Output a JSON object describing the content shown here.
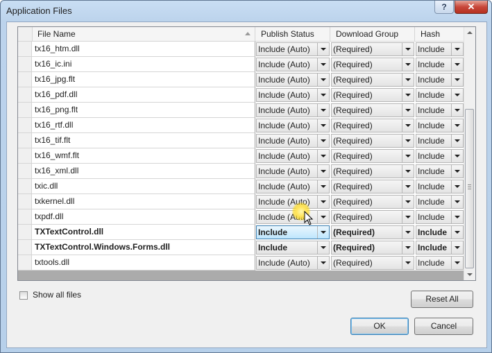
{
  "window": {
    "title": "Application Files",
    "help_label": "?",
    "close_label": "✕"
  },
  "grid": {
    "columns": {
      "name": "File Name",
      "status": "Publish Status",
      "group": "Download Group",
      "hash": "Hash"
    },
    "rows": [
      {
        "name": "tx16_htm.dll",
        "status": "Include (Auto)",
        "group": "(Required)",
        "hash": "Include"
      },
      {
        "name": "tx16_ic.ini",
        "status": "Include (Auto)",
        "group": "(Required)",
        "hash": "Include"
      },
      {
        "name": "tx16_jpg.flt",
        "status": "Include (Auto)",
        "group": "(Required)",
        "hash": "Include"
      },
      {
        "name": "tx16_pdf.dll",
        "status": "Include (Auto)",
        "group": "(Required)",
        "hash": "Include"
      },
      {
        "name": "tx16_png.flt",
        "status": "Include (Auto)",
        "group": "(Required)",
        "hash": "Include"
      },
      {
        "name": "tx16_rtf.dll",
        "status": "Include (Auto)",
        "group": "(Required)",
        "hash": "Include"
      },
      {
        "name": "tx16_tif.flt",
        "status": "Include (Auto)",
        "group": "(Required)",
        "hash": "Include"
      },
      {
        "name": "tx16_wmf.flt",
        "status": "Include (Auto)",
        "group": "(Required)",
        "hash": "Include"
      },
      {
        "name": "tx16_xml.dll",
        "status": "Include (Auto)",
        "group": "(Required)",
        "hash": "Include"
      },
      {
        "name": "txic.dll",
        "status": "Include (Auto)",
        "group": "(Required)",
        "hash": "Include"
      },
      {
        "name": "txkernel.dll",
        "status": "Include (Auto)",
        "group": "(Required)",
        "hash": "Include"
      },
      {
        "name": "txpdf.dll",
        "status": "Include (Auto)",
        "group": "(Required)",
        "hash": "Include"
      },
      {
        "name": "TXTextControl.dll",
        "status": "Include",
        "group": "(Required)",
        "hash": "Include"
      },
      {
        "name": "TXTextControl.Windows.Forms.dll",
        "status": "Include",
        "group": "(Required)",
        "hash": "Include"
      },
      {
        "name": "txtools.dll",
        "status": "Include (Auto)",
        "group": "(Required)",
        "hash": "Include"
      }
    ]
  },
  "options": {
    "show_all_files": "Show all files"
  },
  "buttons": {
    "reset_all": "Reset All",
    "ok": "OK",
    "cancel": "Cancel"
  }
}
